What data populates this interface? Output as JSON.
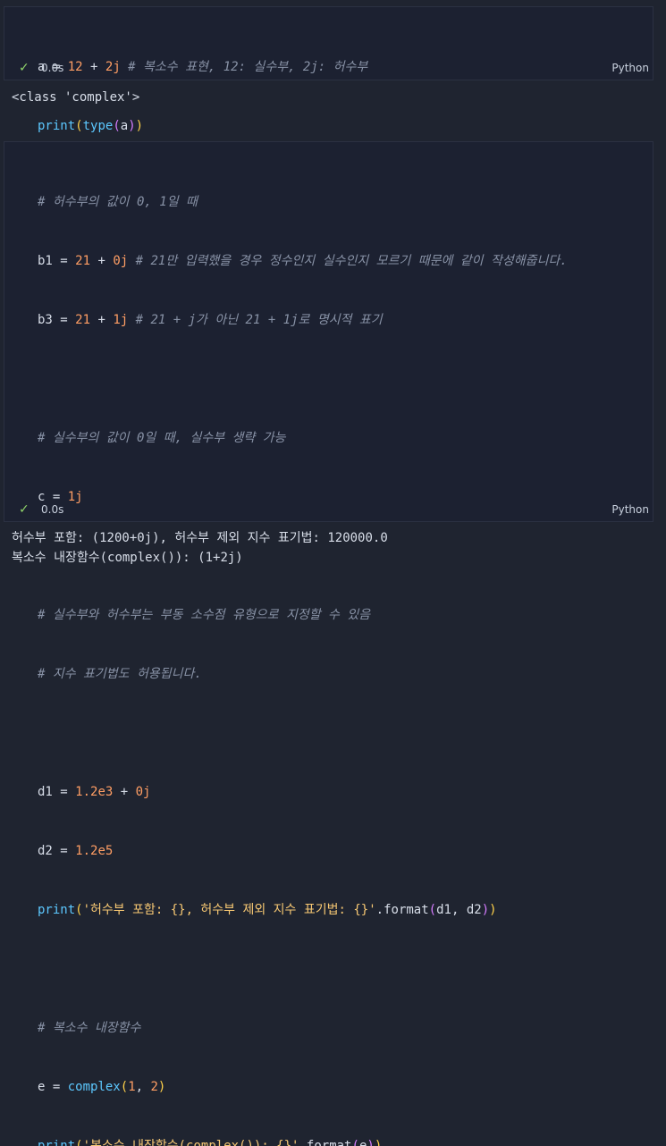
{
  "cell1": {
    "lines": [
      [
        "a",
        " = ",
        "12",
        " + ",
        "2j",
        " # 복소수 표현, 12: 실수부, 2j: 허수부"
      ],
      [
        "print",
        "(",
        "type",
        "(",
        "a",
        ")",
        ")"
      ]
    ],
    "time": "0.0s",
    "language": "Python",
    "output": [
      "<class 'complex'>"
    ]
  },
  "cell2": {
    "lines": {
      "c1": "# 허수부의 값이 0, 1일 때",
      "b1": [
        "b1",
        " = ",
        "21",
        " + ",
        "0j",
        " # 21만 입력했을 경우 정수인지 실수인지 모르기 때문에 같이 작성해줍니다."
      ],
      "b3": [
        "b3",
        " = ",
        "21",
        " + ",
        "1j",
        " # 21 + j가 아닌 21 + 1j로 명시적 표기"
      ],
      "c2": "# 실수부의 값이 0일 때, 실수부 생략 가능",
      "c": [
        "c",
        " = ",
        "1j"
      ],
      "c3": "# 실수부와 허수부는 부동 소수점 유형으로 지정할 수 있음",
      "c4": "# 지수 표기법도 허용됩니다.",
      "d1": [
        "d1",
        " = ",
        "1.2e3",
        " + ",
        "0j"
      ],
      "d2": [
        "d2",
        " = ",
        "1.2e5"
      ],
      "print1": [
        "print",
        "(",
        "'허수부 포함: {}, 허수부 제외 지수 표기법: {}'",
        ".format",
        "(",
        "d1",
        ", ",
        "d2",
        ")",
        ")"
      ],
      "c5": "# 복소수 내장함수",
      "e": [
        "e",
        " = ",
        "complex",
        "(",
        "1",
        ", ",
        "2",
        ")"
      ],
      "print2": [
        "print",
        "(",
        "'복소수 내장함수(complex()): {}'",
        ".format",
        "(",
        "e",
        ")",
        ")"
      ]
    },
    "time": "0.0s",
    "language": "Python",
    "output": [
      "허수부 포함: (1200+0j), 허수부 제외 지수 표기법: 120000.0",
      "복소수 내장함수(complex()): (1+2j)"
    ]
  }
}
